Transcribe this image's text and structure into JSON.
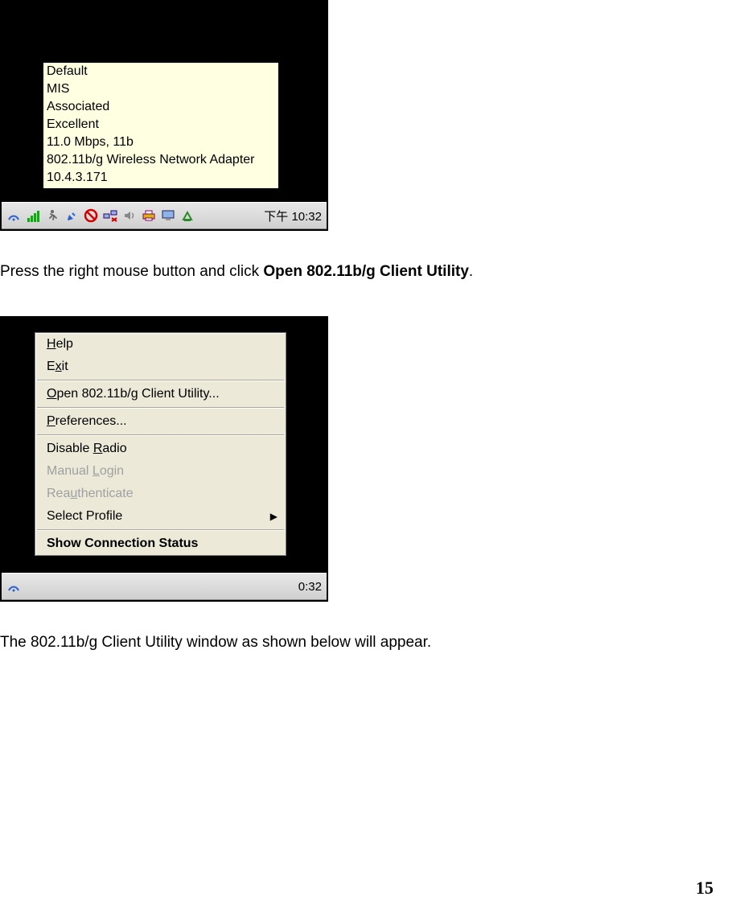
{
  "figure1": {
    "tooltip_lines": [
      "Default",
      "MIS",
      "Associated",
      "Excellent",
      "11.0 Mbps, 11b",
      "802.11b/g Wireless Network Adapter",
      "10.4.3.171"
    ],
    "clock": "下午 10:32"
  },
  "para1_pre": "Press the right mouse button and click ",
  "para1_bold": "Open 802.11b/g Client Utility",
  "para1_post": ".",
  "figure2": {
    "menu": {
      "help": "Help",
      "exit": "Exit",
      "open": "Open 802.11b/g Client Utility...",
      "prefs": "Preferences...",
      "disable_pre": "Disable ",
      "disable_ul": "R",
      "disable_post": "adio",
      "manual_pre": "Manual ",
      "manual_ul": "L",
      "manual_post": "ogin",
      "reauth_pre": "Rea",
      "reauth_ul": "u",
      "reauth_post": "thenticate",
      "select_profile": "Select Profile",
      "show_status": "Show Connection Status"
    },
    "clock": "0:32"
  },
  "para2": "The 802.11b/g Client Utility window as shown below will appear.",
  "page_number": "15"
}
